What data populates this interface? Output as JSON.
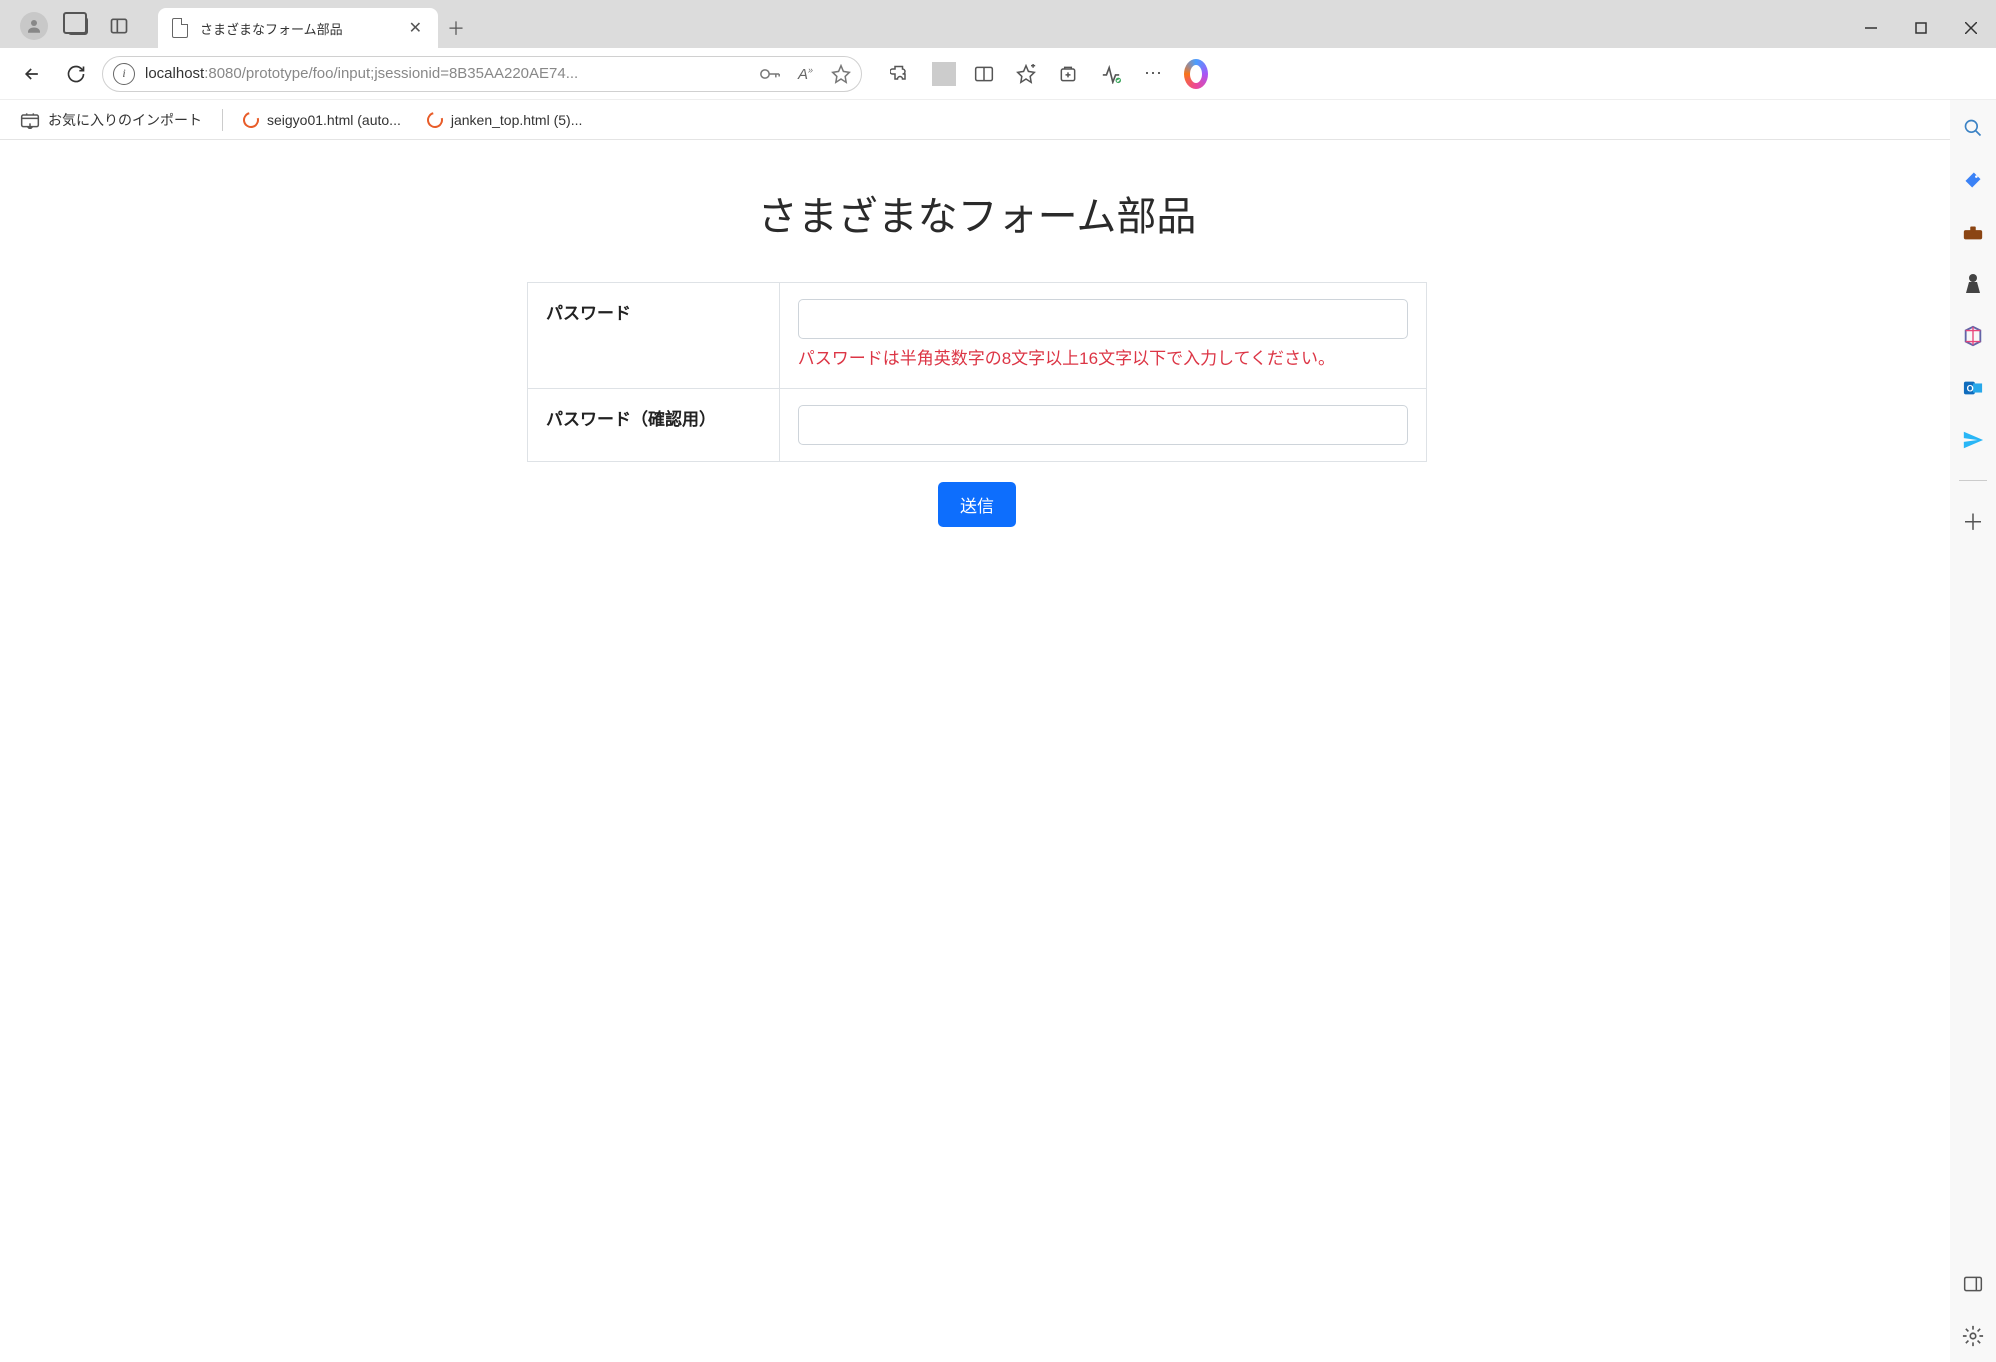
{
  "window": {
    "tab_title": "さまざまなフォーム部品"
  },
  "address": {
    "host": "localhost",
    "path_display": ":8080/prototype/foo/input;jsessionid=8B35AA220AE74..."
  },
  "bookmarks": {
    "import_label": "お気に入りのインポート",
    "items": [
      {
        "label": "seigyo01.html (auto..."
      },
      {
        "label": "janken_top.html (5)..."
      }
    ]
  },
  "page": {
    "heading": "さまざまなフォーム部品",
    "rows": {
      "password_label": "パスワード",
      "password_error": "パスワードは半角英数字の8文字以上16文字以下で入力してください。",
      "password_confirm_label": "パスワード（確認用）"
    },
    "submit_label": "送信"
  }
}
